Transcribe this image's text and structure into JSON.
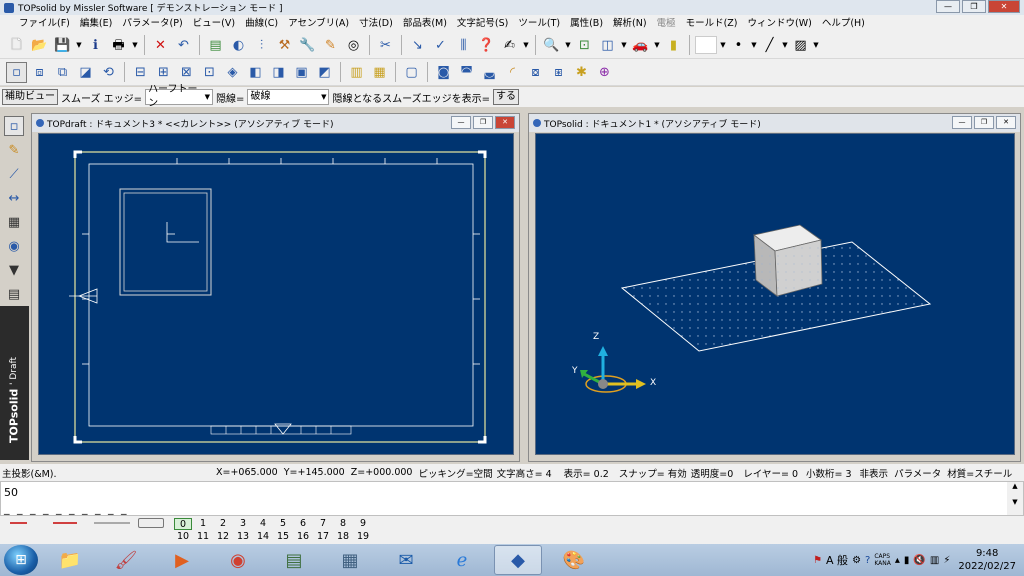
{
  "app": {
    "title": "TOPsolid by Missler Software [ デモンストレーション モード ]"
  },
  "menu": [
    "ファイル(F)",
    "編集(E)",
    "パラメータ(P)",
    "ビュー(V)",
    "曲線(C)",
    "アセンブリ(A)",
    "寸法(D)",
    "部品表(M)",
    "文字記号(S)",
    "ツール(T)",
    "属性(B)",
    "解析(N)",
    "電極",
    "モールド(Z)",
    "ウィンドウ(W)",
    "ヘルプ(H)"
  ],
  "property_bar": {
    "aux_view_button": "補助ビュー",
    "smooth_edge_label": "スムーズ エッジ=",
    "smooth_edge_value": "ハーフトーン",
    "hidden_line_label": "隠線=",
    "hidden_line_value": "破線",
    "hidden_smooth_label": "隠線となるスムーズエッジを表示=",
    "hidden_smooth_button": "する"
  },
  "sidebar": {
    "brand_main": "TOPsolid",
    "brand_sub": "' Draft"
  },
  "windows": {
    "left": {
      "title": "TOPdraft : ドキュメント3 *  <<カレント>> (アソシアティブ モード)"
    },
    "right": {
      "title": "TOPsolid : ドキュメント1 * (アソシアティブ モード)"
    }
  },
  "axes": {
    "x": "X",
    "y": "Y",
    "z": "Z"
  },
  "status": {
    "prompt": "主投影(&M).",
    "x": "X=+065.000",
    "y": "Y=+145.000",
    "z": "Z=+000.000",
    "picking": "ピッキング=空間",
    "text_height": "文字高さ=  4",
    "display": "表示=  0.2",
    "snap": "スナップ= 有効",
    "transparency": "透明度=0",
    "layer": "レイヤー=  0",
    "decimals": "小数桁= 3",
    "hidden": "非表示",
    "parameter": "パラメータ",
    "material": "材質=スチール"
  },
  "command": {
    "value": "50",
    "dashes": "_ _ _ _ _ _ _ _ _ _"
  },
  "layers": {
    "row1": [
      "0",
      "1",
      "2",
      "3",
      "4",
      "5",
      "6",
      "7",
      "8",
      "9"
    ],
    "row2": [
      "10",
      "11",
      "12",
      "13",
      "14",
      "15",
      "16",
      "17",
      "18",
      "19"
    ]
  },
  "taskbar": {
    "time": "9:48",
    "date": "2022/02/27",
    "ime": "A 般",
    "caps": "CAPS",
    "kana": "KANA"
  },
  "colors": {
    "canvas": "#003470",
    "frame_yellow": "#e8e8a0",
    "accent": "#2a5aa8"
  }
}
